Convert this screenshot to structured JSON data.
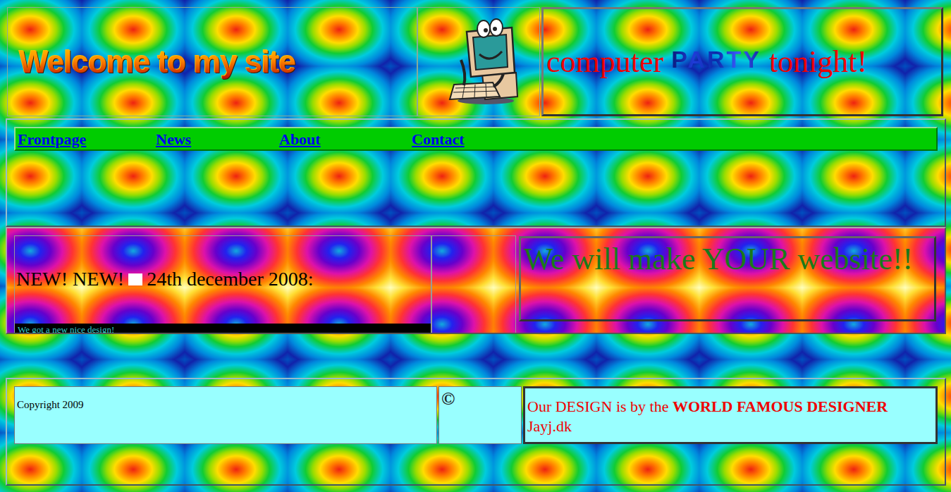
{
  "header": {
    "welcome": "Welcome to my site",
    "party_before": "computer ",
    "party_word": "PARTY",
    "party_after": " tonight!"
  },
  "nav": [
    {
      "label": "Frontpage"
    },
    {
      "label": "News"
    },
    {
      "label": "About"
    },
    {
      "label": "Contact"
    }
  ],
  "news": {
    "badge": "NEW! NEW!",
    "date": "24th december 2008:",
    "text": "We got a new nice design!"
  },
  "promo": "We will make YOUR website!!",
  "footer": {
    "copyright": "Copyright 2009",
    "symbol": "©",
    "credit_before": "Our DESIGN is by the ",
    "credit_bold": "WORLD FAMOUS DESIGNER",
    "credit_after": "Jayj.dk"
  }
}
